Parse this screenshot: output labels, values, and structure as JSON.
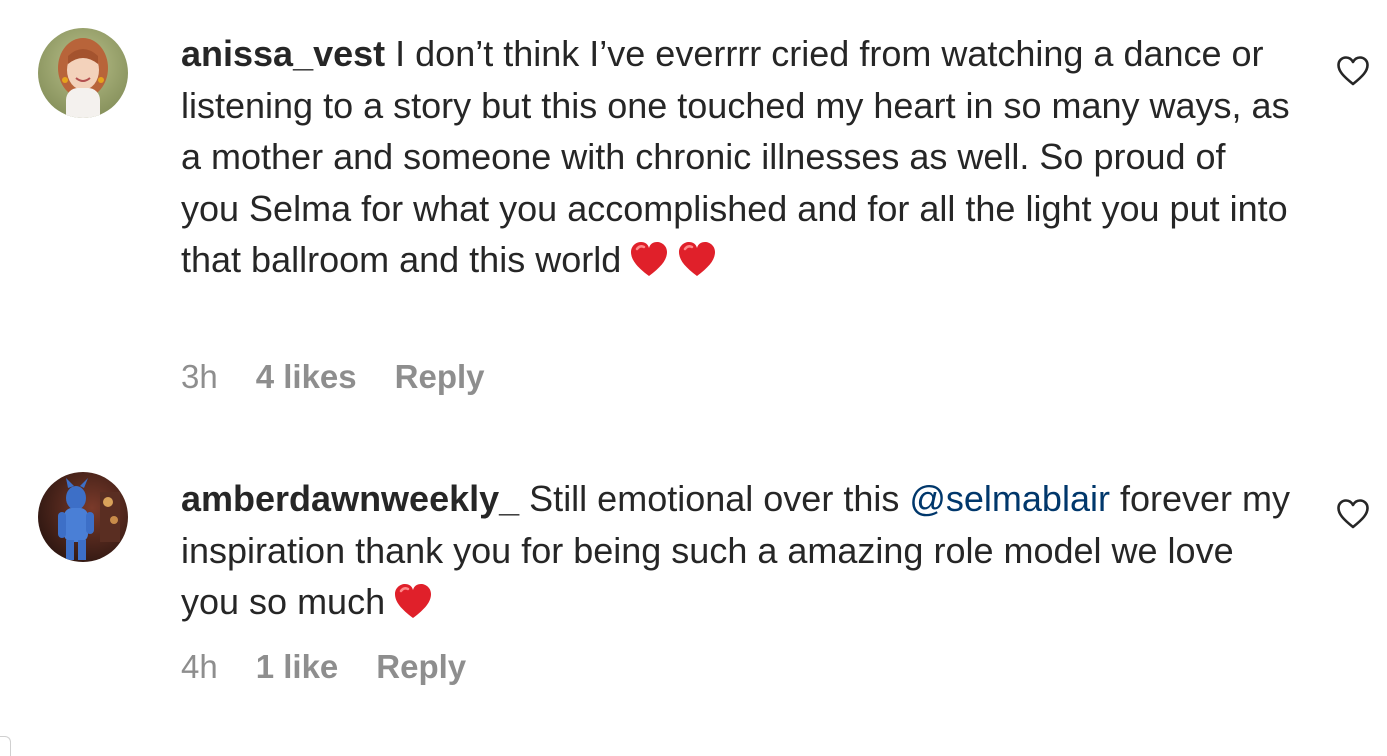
{
  "comments": [
    {
      "username": "anissa_vest",
      "text": " I don’t think I’ve everrrr cried from watching a dance or listening to a story but this one touched my heart in so many ways, as a mother and someone with chronic illnesses as well. So proud of you Selma for what you accomplished and for all the light you put into that ballroom and this world",
      "emojis": [
        "red-heart",
        "red-heart"
      ],
      "time": "3h",
      "likes": "4 likes",
      "reply_label": "Reply",
      "avatar": "avatar-photo-woman-red-hair"
    },
    {
      "username": "amberdawnweekly_",
      "text_before_mention": " Still emotional over this ",
      "mention": "@selmablair",
      "text_after_mention": " forever my inspiration thank you for being such a amazing role model we love you so much",
      "emojis": [
        "red-heart"
      ],
      "time": "4h",
      "likes": "1 like",
      "reply_label": "Reply",
      "avatar": "avatar-photo-costume"
    }
  ],
  "icons": {
    "like": "heart-outline-icon",
    "emoji": "red-heart-emoji"
  },
  "colors": {
    "text": "#262626",
    "meta": "#8e8e8e",
    "mention": "#00376b",
    "heart_emoji": "#e0202a"
  }
}
